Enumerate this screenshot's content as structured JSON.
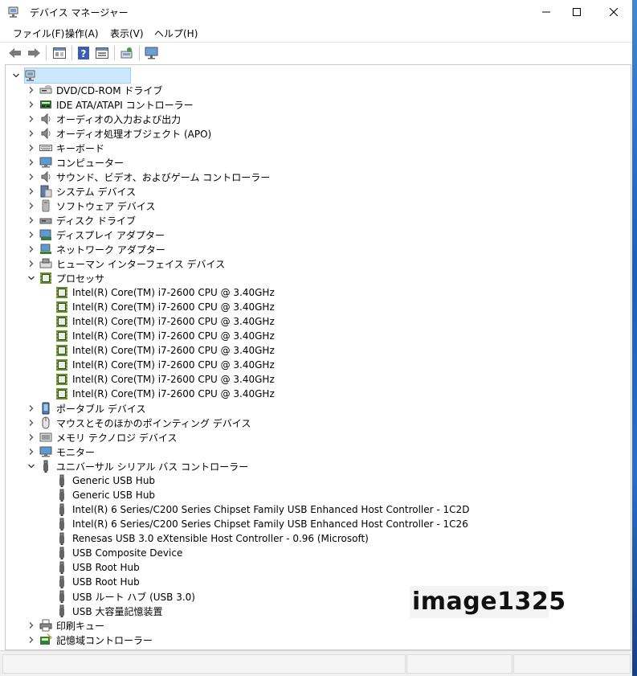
{
  "window": {
    "title": "デバイス マネージャー",
    "icon": "device-manager-icon"
  },
  "menu": [
    "ファイル(F)",
    "操作(A)",
    "表示(V)",
    "ヘルプ(H)"
  ],
  "toolbar": [
    "back-icon",
    "forward-icon",
    "properties-view-icon",
    "help-icon",
    "action-view-icon",
    "scan-hardware-icon",
    "monitor-icon"
  ],
  "tree": {
    "root_label": "",
    "categories": [
      {
        "label": "DVD/CD-ROM ドライブ",
        "icon": "dvd-drive-icon",
        "expanded": false
      },
      {
        "label": "IDE ATA/ATAPI コントローラー",
        "icon": "ide-controller-icon",
        "expanded": false
      },
      {
        "label": "オーディオの入力および出力",
        "icon": "speaker-icon",
        "expanded": false
      },
      {
        "label": "オーディオ処理オブジェクト (APO)",
        "icon": "speaker-icon",
        "expanded": false
      },
      {
        "label": "キーボード",
        "icon": "keyboard-icon",
        "expanded": false
      },
      {
        "label": "コンピューター",
        "icon": "computer-icon",
        "expanded": false
      },
      {
        "label": "サウンド、ビデオ、およびゲーム コントローラー",
        "icon": "speaker-icon",
        "expanded": false
      },
      {
        "label": "システム デバイス",
        "icon": "system-device-icon",
        "expanded": false
      },
      {
        "label": "ソフトウェア デバイス",
        "icon": "software-device-icon",
        "expanded": false
      },
      {
        "label": "ディスク ドライブ",
        "icon": "disk-drive-icon",
        "expanded": false
      },
      {
        "label": "ディスプレイ アダプター",
        "icon": "display-adapter-icon",
        "expanded": false
      },
      {
        "label": "ネットワーク アダプター",
        "icon": "network-adapter-icon",
        "expanded": false
      },
      {
        "label": "ヒューマン インターフェイス デバイス",
        "icon": "hid-icon",
        "expanded": false
      },
      {
        "label": "プロセッサ",
        "icon": "processor-icon",
        "expanded": true,
        "children": [
          "Intel(R) Core(TM) i7-2600 CPU @ 3.40GHz",
          "Intel(R) Core(TM) i7-2600 CPU @ 3.40GHz",
          "Intel(R) Core(TM) i7-2600 CPU @ 3.40GHz",
          "Intel(R) Core(TM) i7-2600 CPU @ 3.40GHz",
          "Intel(R) Core(TM) i7-2600 CPU @ 3.40GHz",
          "Intel(R) Core(TM) i7-2600 CPU @ 3.40GHz",
          "Intel(R) Core(TM) i7-2600 CPU @ 3.40GHz",
          "Intel(R) Core(TM) i7-2600 CPU @ 3.40GHz"
        ],
        "child_icon": "processor-icon"
      },
      {
        "label": "ポータブル デバイス",
        "icon": "portable-device-icon",
        "expanded": false
      },
      {
        "label": "マウスとそのほかのポインティング デバイス",
        "icon": "mouse-icon",
        "expanded": false
      },
      {
        "label": "メモリ テクノロジ デバイス",
        "icon": "memory-device-icon",
        "expanded": false
      },
      {
        "label": "モニター",
        "icon": "monitor-icon",
        "expanded": false
      },
      {
        "label": "ユニバーサル シリアル バス コントローラー",
        "icon": "usb-icon",
        "expanded": true,
        "children": [
          "Generic USB Hub",
          "Generic USB Hub",
          "Intel(R) 6 Series/C200 Series Chipset Family USB Enhanced Host Controller - 1C2D",
          "Intel(R) 6 Series/C200 Series Chipset Family USB Enhanced Host Controller - 1C26",
          "Renesas USB 3.0 eXtensible Host Controller - 0.96 (Microsoft)",
          "USB Composite Device",
          "USB Root Hub",
          "USB Root Hub",
          "USB ルート ハブ (USB 3.0)",
          "USB 大容量記憶装置"
        ],
        "child_icon": "usb-icon"
      },
      {
        "label": "印刷キュー",
        "icon": "printer-icon",
        "expanded": false
      },
      {
        "label": "記憶域コントローラー",
        "icon": "storage-controller-icon",
        "expanded": false
      }
    ]
  },
  "watermark": "image1325",
  "colors": {
    "selection": "#cce8ff",
    "chip_green": "#5f8f2e",
    "window_bg": "#ffffff"
  }
}
